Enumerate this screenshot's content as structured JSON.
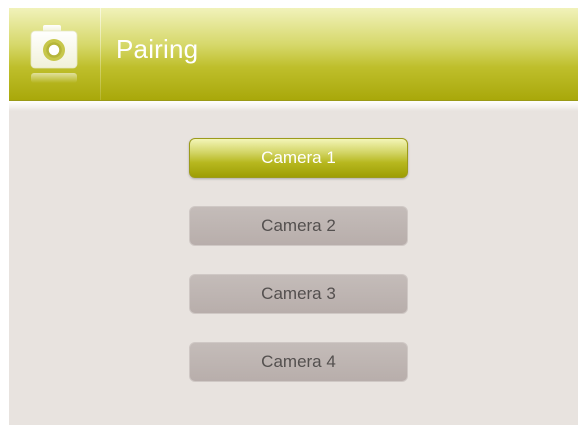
{
  "header": {
    "title": "Pairing",
    "icon": "camera-icon"
  },
  "cameras": [
    {
      "label": "Camera 1",
      "selected": true
    },
    {
      "label": "Camera 2",
      "selected": false
    },
    {
      "label": "Camera 3",
      "selected": false
    },
    {
      "label": "Camera 4",
      "selected": false
    }
  ],
  "colors": {
    "accent": "#b7b81f",
    "background": "#e8e3df",
    "button_normal": "#bcb3b0"
  }
}
